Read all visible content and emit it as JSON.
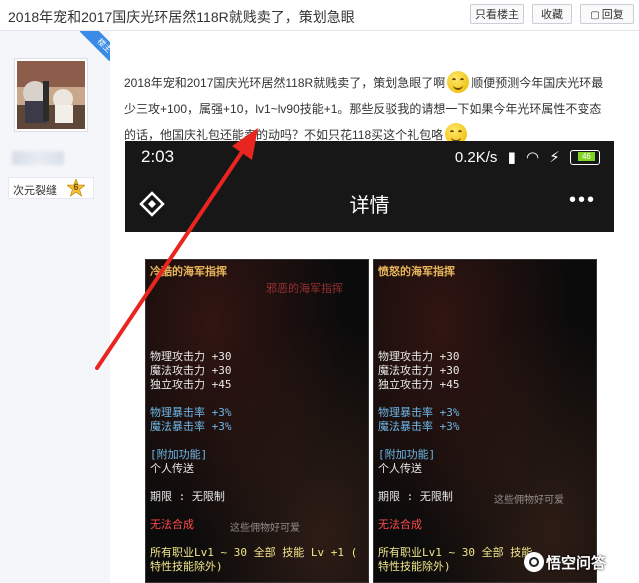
{
  "thread": {
    "title": "2018年宠和2017国庆光环居然118R就贱卖了，策划急眼",
    "buttons": [
      {
        "label": "只看楼主"
      },
      {
        "label": "收藏"
      },
      {
        "label": "回复",
        "icon": "reply-icon"
      }
    ]
  },
  "user": {
    "badge": "楼主",
    "name": "次元裂缝",
    "level": "6"
  },
  "post": {
    "line1": "2018年宠和2017国庆光环居然118R就贱卖了，策划急眼了啊",
    "line1b": "顺便预测今年国庆光环最",
    "line2": "少三攻+100，属强+10，lv1~lv90技能+1。那些反驳我的请想一下如果今年光环属性不变态",
    "line3": "的话，他国庆礼包还能卖的动吗？不如只花118买这个礼包咯"
  },
  "phone": {
    "time": "2:03",
    "network": "0.2K/s",
    "battery": "46",
    "title": "详情",
    "more": "•••"
  },
  "cards": [
    {
      "name": "冷酷的海军指挥",
      "ghost": "邪恶的海军指挥",
      "stats": [
        "物理攻击力 +30",
        "魔法攻击力 +30",
        "独立攻击力 +45"
      ],
      "crit": [
        "物理暴击率 +3%",
        "魔法暴击率 +3%"
      ],
      "func_header": "[附加功能]",
      "func": "个人传送",
      "limit": "期限 : 无限制",
      "nocraft": "无法合成",
      "ghost2": "这些佣物好可爱",
      "skill1": "所有职业Lv1 ~ 30 全部 技能 Lv +1 (",
      "skill2": "特性技能除外)"
    },
    {
      "name": "愤怒的海军指挥",
      "stats": [
        "物理攻击力 +30",
        "魔法攻击力 +30",
        "独立攻击力 +45"
      ],
      "crit": [
        "物理暴击率 +3%",
        "魔法暴击率 +3%"
      ],
      "func_header": "[附加功能]",
      "func": "个人传送",
      "limit": "期限 : 无限制",
      "nocraft": "无法合成",
      "ghost2": "这些佣物好可爱",
      "skill1": "所有职业Lv1 ~ 30 全部 技能",
      "skill2": "特性技能除外)"
    }
  ],
  "watermark": "悟空问答",
  "colors": {
    "accent_arrow": "#e8251f",
    "badge_blue": "#3a8be6",
    "card_name": "#e7b55a",
    "stat_blue": "#6fb8e8",
    "nocraft_red": "#ff4b4b"
  }
}
